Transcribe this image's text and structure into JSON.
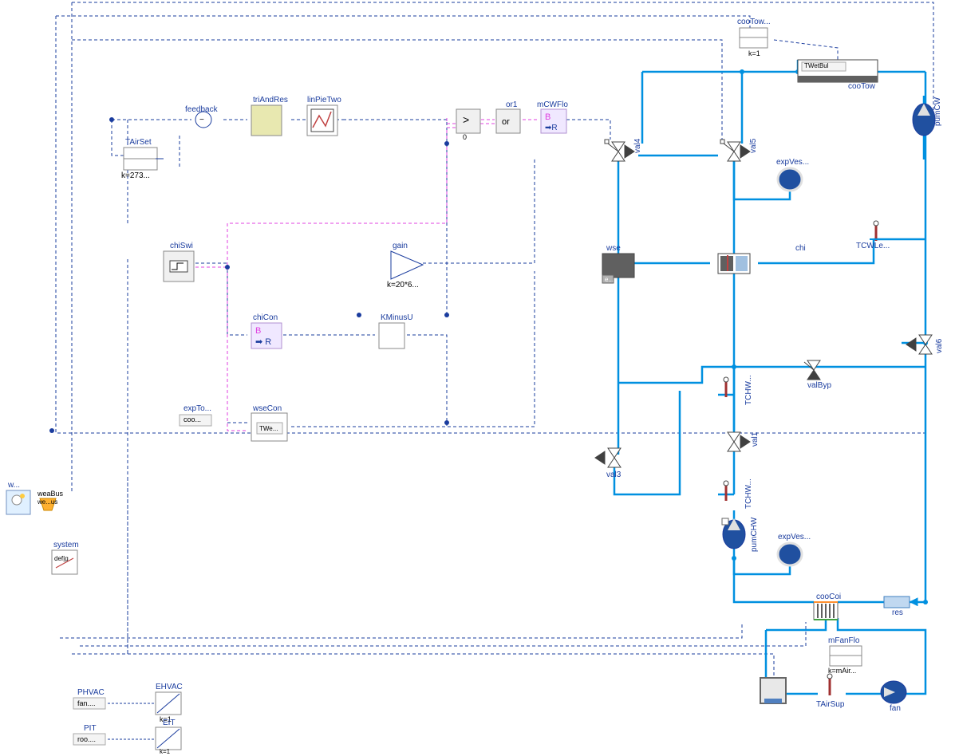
{
  "labels": {
    "feedback": "feedback",
    "triAndRes": "triAndRes",
    "linPieTwo": "linPieTwo",
    "tAirSet": "TAirSet",
    "tAirSetK": "k=273...",
    "chiSwi": "chiSwi",
    "gain": "gain",
    "gainK": "k=20*6...",
    "chiCon": "chiCon",
    "chiConB": "B",
    "chiConR": "➡ R",
    "kMinusU": "KMinusU",
    "or1": "or1",
    "orText": "or",
    "gt": ">",
    "gtZero": "0",
    "mCWFlo": "mCWFlo",
    "mCWFloB": "B",
    "mCWFloR": "➡ R",
    "expTo": "expTo...",
    "coo": "coo...",
    "wseCon": "wseCon",
    "tWe": "TWe...",
    "w": "w...",
    "weaBus": "weaBus",
    "weaBus2": "we...us",
    "system": "system",
    "defG": "def|g",
    "phvac": "PHVAC",
    "fan": "fan....",
    "ehvac": "EHVAC",
    "ehvacK": "k=1",
    "pit": "PIT",
    "roo": "roo....",
    "eit": "EIT",
    "eitK": "k=1",
    "cooTow": "cooTow...",
    "cooTowK": "k=1",
    "tWetBul": "TWetBul",
    "cooTow2": "cooTow",
    "pumCW": "pumCW",
    "val4": "val4",
    "val5": "val5",
    "expVes1": "expVes...",
    "wse": "wse",
    "wseE": "e...",
    "chi": "chi",
    "tcwLe": "TCWLe...",
    "val6": "val6",
    "valByp": "valByp",
    "tchw1": "TCHW...",
    "val1": "val1",
    "val3": "val3",
    "tchw2": "TCHW...",
    "pumCHW": "pumCHW",
    "expVes2": "expVes...",
    "cooCoi": "cooCoi",
    "res": "res",
    "mFanFlo": "mFanFlo",
    "mFanFloK": "k=mAir...",
    "tAirSup": "TAirSup",
    "fanBlock": "fan"
  },
  "chart_data": null
}
